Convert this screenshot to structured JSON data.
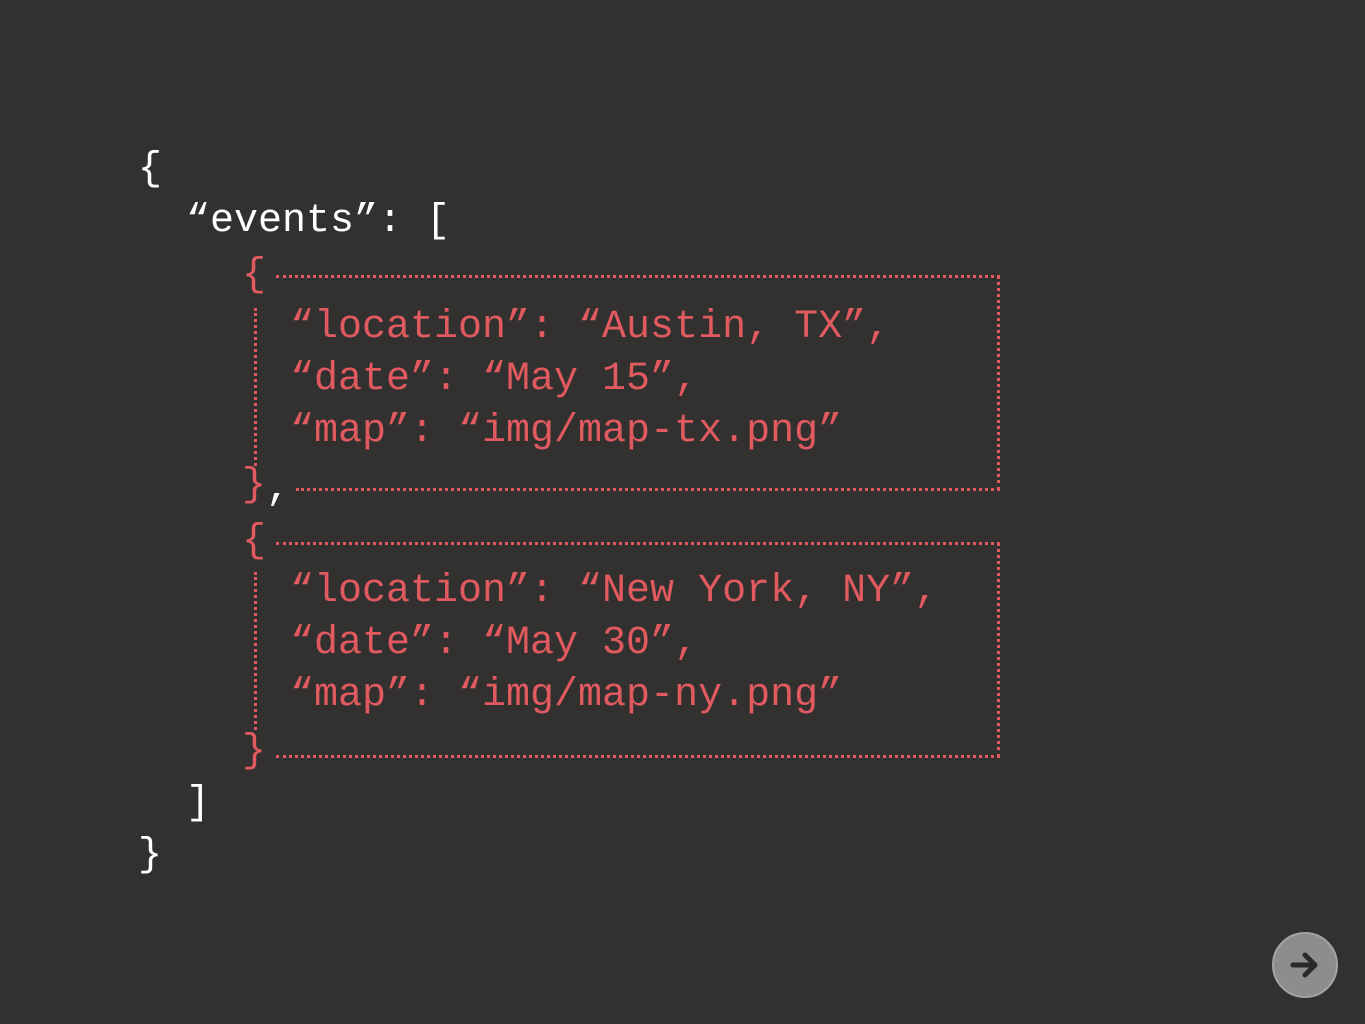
{
  "code": {
    "open_brace": "{",
    "events_key": "“events”: [",
    "events": [
      {
        "open": "{",
        "location_line": "“location”: “Austin, TX”,",
        "date_line": "“date”: “May 15”,",
        "map_line": "“map”: “img/map-tx.png”",
        "close": "}",
        "separator": ","
      },
      {
        "open": "{",
        "location_line": "“location”: “New York, NY”,",
        "date_line": "“date”: “May 30”,",
        "map_line": "“map”: “img/map-ny.png”",
        "close": "}"
      }
    ],
    "close_bracket": "]",
    "close_brace": "}"
  },
  "navigation": {
    "next_icon": "arrow-right-icon"
  },
  "colors": {
    "background": "#323130",
    "text": "#ffffff",
    "highlight": "#e05a5f",
    "button": "#8d8d8d"
  }
}
